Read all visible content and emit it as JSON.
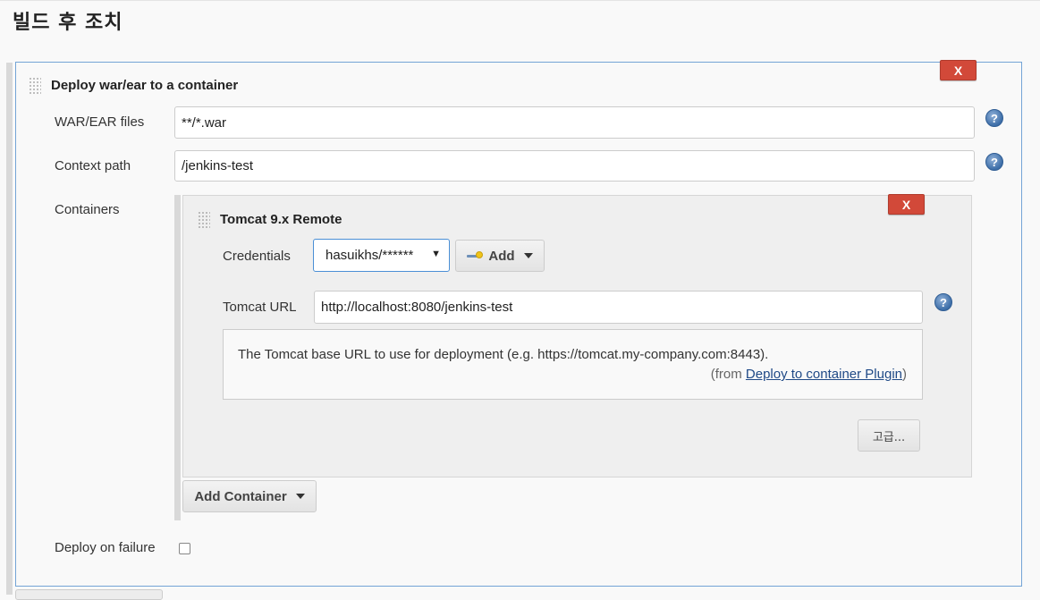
{
  "section": {
    "title": "빌드 후 조치"
  },
  "deploy": {
    "title": "Deploy war/ear to a container",
    "delete_label": "X",
    "war_label": "WAR/EAR files",
    "war_value": "**/*.war",
    "context_label": "Context path",
    "context_value": "/jenkins-test",
    "containers_label": "Containers",
    "add_container_label": "Add Container",
    "deploy_on_failure_label": "Deploy on failure",
    "deploy_on_failure_checked": false
  },
  "tomcat": {
    "title": "Tomcat 9.x Remote",
    "delete_label": "X",
    "credentials_label": "Credentials",
    "credentials_value": "hasuikhs/******",
    "add_label": "Add",
    "url_label": "Tomcat URL",
    "url_value": "http://localhost:8080/jenkins-test",
    "help_text": "The Tomcat base URL to use for deployment (e.g. https://tomcat.my-company.com:8443).",
    "help_from_prefix": "(from ",
    "help_link": "Deploy to container Plugin",
    "help_from_suffix": ")",
    "advanced_label": "고급..."
  },
  "icons": {
    "help": "help-icon",
    "drag": "drag-handle-icon",
    "key": "key-icon",
    "dropdown": "chevron-down-icon"
  },
  "colors": {
    "delete": "#d24939",
    "panel_border": "#74a4d6",
    "link": "#204a87",
    "help_icon": "#3d6ea8"
  }
}
